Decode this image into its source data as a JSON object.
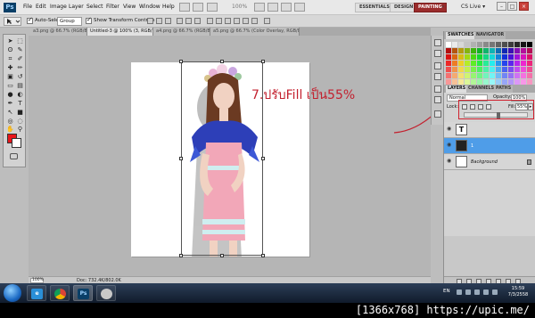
{
  "app": {
    "logo": "Ps",
    "menu": [
      "File",
      "Edit",
      "Image",
      "Layer",
      "Select",
      "Filter",
      "View",
      "Window",
      "Help"
    ],
    "zoom": "100%",
    "workspaces": [
      "ESSENTIALS",
      "DESIGN",
      "PAINTING"
    ],
    "active_workspace": "PAINTING",
    "cs_live": "CS Live ▾",
    "window_buttons": [
      "–",
      "□",
      "×"
    ]
  },
  "options": {
    "auto_select_label": "Auto-Select:",
    "auto_select_value": "Group",
    "show_transform_label": "Show Transform Controls"
  },
  "doc_tabs": [
    "a3.png @ 66.7% (RGB/8#)",
    "Untitled-3 @ 100% (3, RGB/8)",
    "a4.png @ 66.7% (RGB/8#)",
    "a5.png @ 66.7% (Color Overlay, RGB/8#)"
  ],
  "active_doc_tab": 1,
  "annotation": {
    "text": "7.ปรับFill เป็น55%",
    "color": "#c3202e"
  },
  "status": {
    "zoom": "100%",
    "doc_info": "Doc: 732.4K/802.0K"
  },
  "panels": {
    "swatch_tabs": [
      "SWATCHES",
      "NAVIGATOR"
    ],
    "layer_tabs": [
      "LAYERS",
      "CHANNELS",
      "PATHS"
    ],
    "blend_mode": "Normal",
    "opacity_label": "Opacity:",
    "opacity_value": "100%",
    "lock_label": "Lock:",
    "fill_label": "Fill:",
    "fill_value": "55%",
    "fill_fraction": 0.55,
    "layers": [
      {
        "name": "",
        "selected": false
      },
      {
        "name": "1",
        "selected": true
      },
      {
        "name": "Background",
        "selected": false
      }
    ]
  },
  "taskbar": {
    "apps": [
      "ie",
      "chrome",
      "photoshop",
      "cd"
    ],
    "photoshop_glyph": "Ps",
    "lang": "EN",
    "time": "15:59",
    "date": "7/3/2558"
  },
  "watermark": "[1366x768] https://upic.me/",
  "colors": {
    "foreground": "#e8161b",
    "background": "#ffffff",
    "selected_layer": "#4f9de8",
    "highlight": "#d0212e"
  }
}
